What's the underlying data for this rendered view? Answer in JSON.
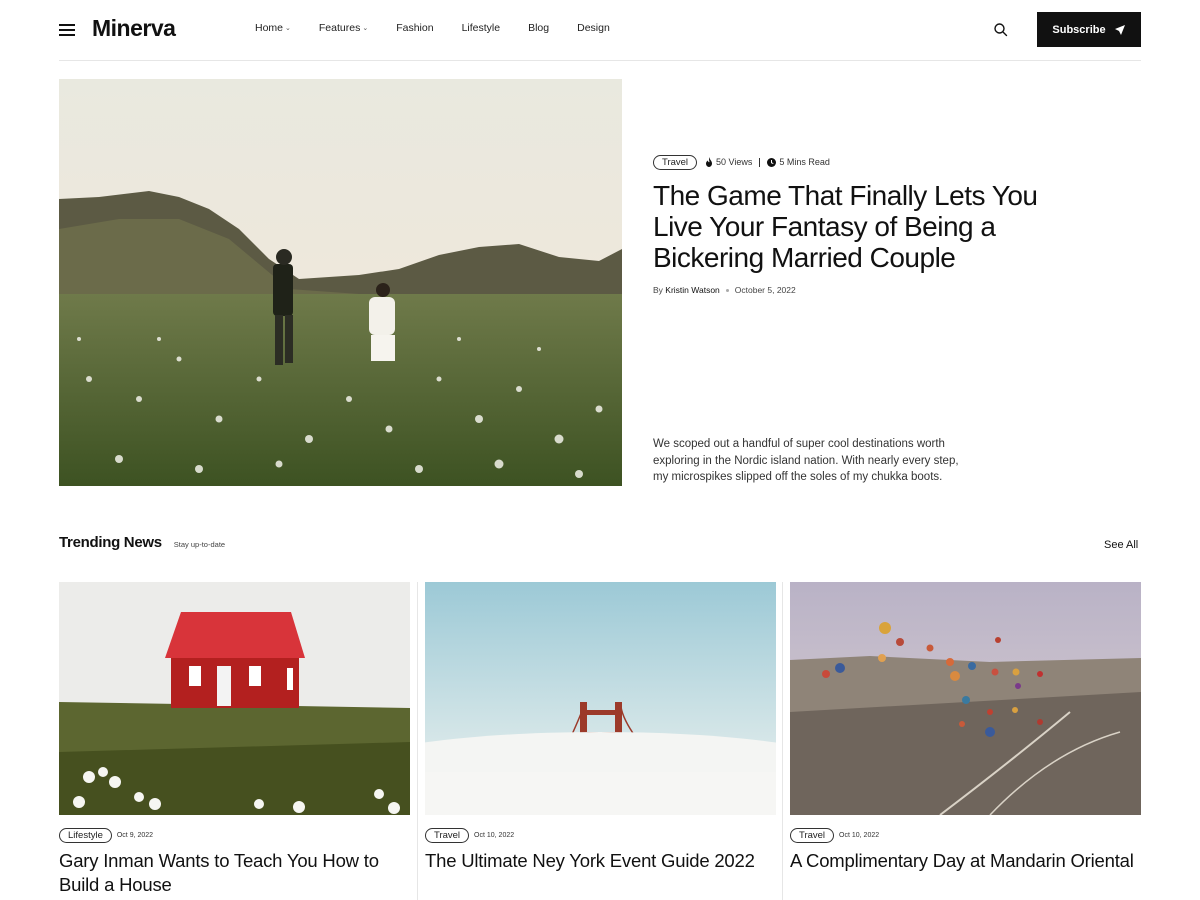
{
  "header": {
    "logo": "Minerva",
    "nav": [
      {
        "label": "Home",
        "has_dropdown": true
      },
      {
        "label": "Features",
        "has_dropdown": true
      },
      {
        "label": "Fashion",
        "has_dropdown": false
      },
      {
        "label": "Lifestyle",
        "has_dropdown": false
      },
      {
        "label": "Blog",
        "has_dropdown": false
      },
      {
        "label": "Design",
        "has_dropdown": false
      }
    ],
    "subscribe_label": "Subscribe"
  },
  "hero": {
    "category": "Travel",
    "views": "50 Views",
    "read_time": "5 Mins Read",
    "title": "The Game That Finally Lets You Live Your Fantasy of Being a Bickering Married Couple",
    "by": "By",
    "author": "Kristin Watson",
    "date": "October 5, 2022",
    "excerpt": "We scoped out a handful of super cool destinations worth exploring in the Nordic island nation. With nearly every step, my microspikes slipped off the soles of my chukka boots."
  },
  "trending": {
    "title": "Trending News",
    "subtitle": "Stay up-to-date",
    "see_all": "See All",
    "cards": [
      {
        "category": "Lifestyle",
        "date": "Oct 9, 2022",
        "title": "Gary Inman Wants to Teach You How to Build a House"
      },
      {
        "category": "Travel",
        "date": "Oct 10, 2022",
        "title": "The Ultimate Ney York Event Guide 2022"
      },
      {
        "category": "Travel",
        "date": "Oct 10, 2022",
        "title": "A Complimentary Day at Mandarin Oriental"
      }
    ]
  },
  "colors": {
    "accent": "#111111",
    "border": "#e6e6e6",
    "background": "#ffffff"
  }
}
